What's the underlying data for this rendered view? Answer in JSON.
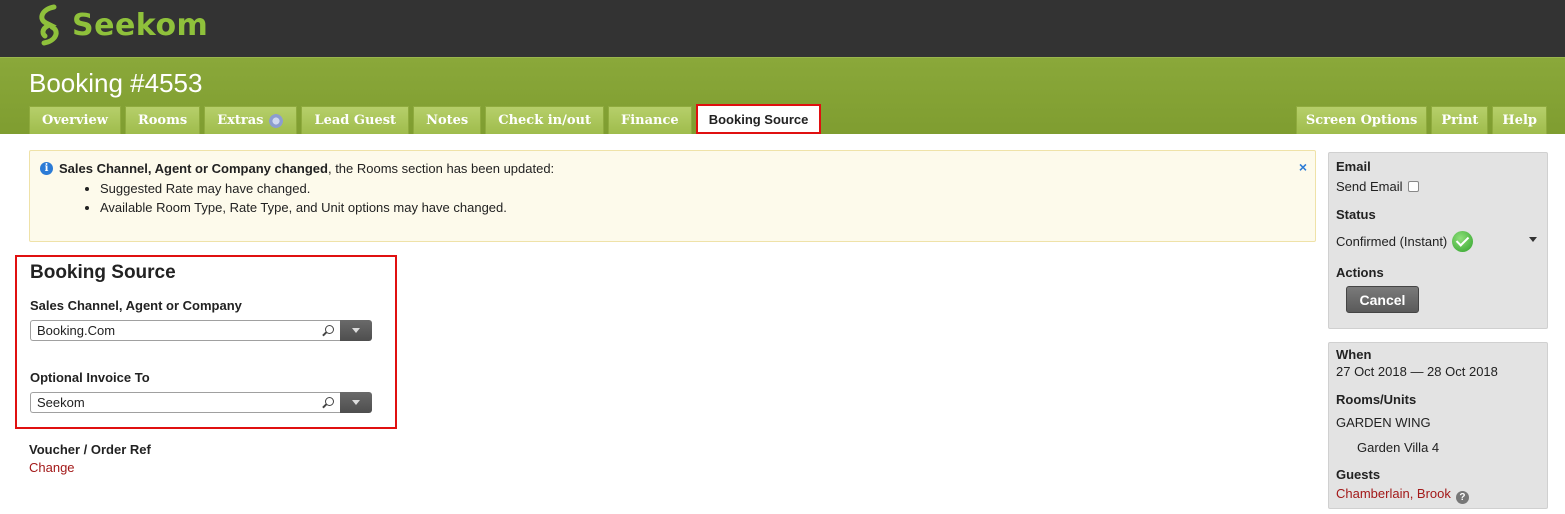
{
  "brand": {
    "name": "Seekom",
    "logo_color": "#8fc13b"
  },
  "header": {
    "title": "Booking #4553"
  },
  "tabs": [
    {
      "label": "Overview"
    },
    {
      "label": "Rooms"
    },
    {
      "label": "Extras"
    },
    {
      "label": "Lead Guest"
    },
    {
      "label": "Notes"
    },
    {
      "label": "Check in/out"
    },
    {
      "label": "Finance"
    },
    {
      "label": "Booking Source",
      "active": true
    }
  ],
  "right_tabs": [
    {
      "label": "Screen Options"
    },
    {
      "label": "Print"
    },
    {
      "label": "Help"
    }
  ],
  "notice": {
    "bold": "Sales Channel, Agent or Company changed",
    "text": ", the Rooms section has been updated:",
    "items": [
      "Suggested Rate may have changed.",
      "Available Room Type, Rate Type, and Unit options may have changed."
    ],
    "close": "×"
  },
  "booking_source": {
    "title": "Booking Source",
    "sales_channel_label": "Sales Channel, Agent or Company",
    "sales_channel_value": "Booking.Com",
    "invoice_label": "Optional Invoice To",
    "invoice_value": "Seekom"
  },
  "voucher": {
    "label": "Voucher / Order Ref",
    "link": "Change"
  },
  "sidebar": {
    "email_head": "Email",
    "send_email": "Send Email",
    "status_head": "Status",
    "status_value": "Confirmed (Instant)",
    "actions_head": "Actions",
    "cancel": "Cancel",
    "when_head": "When",
    "when_value": "27 Oct 2018 — 28 Oct 2018",
    "rooms_head": "Rooms/Units",
    "room_group": "GARDEN WING",
    "room_unit": "Garden Villa 4",
    "guests_head": "Guests",
    "guest_name": "Chamberlain, Brook"
  },
  "colors": {
    "topbar": "#333333",
    "band": "#8aa83a",
    "highlight": "#e01010",
    "link": "#a31919"
  }
}
